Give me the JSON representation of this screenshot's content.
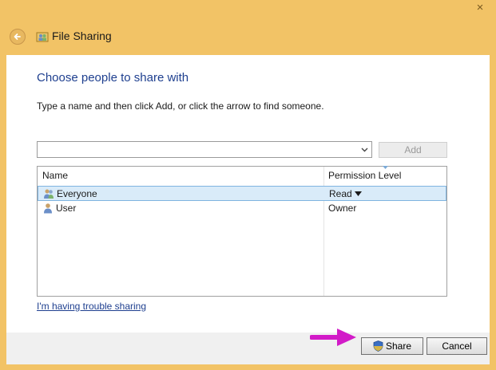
{
  "window": {
    "close_glyph": "×",
    "title": "File Sharing"
  },
  "dialog": {
    "heading": "Choose people to share with",
    "instructions": "Type a name and then click Add, or click the arrow to find someone.",
    "name_input": {
      "value": "",
      "placeholder": ""
    },
    "add_label": "Add",
    "table": {
      "columns": [
        "Name",
        "Permission Level"
      ],
      "rows": [
        {
          "name": "Everyone",
          "permission": "Read",
          "icon": "group-icon",
          "selected": true
        },
        {
          "name": "User",
          "permission": "Owner",
          "icon": "user-icon",
          "selected": false
        }
      ]
    },
    "trouble_link": "I'm having trouble sharing"
  },
  "footer": {
    "share_label": "Share",
    "cancel_label": "Cancel"
  },
  "colors": {
    "frame": "#f2c366",
    "heading": "#1e3f8f",
    "selection": "#d9ebf9",
    "annotation_arrow": "#d21bc8"
  }
}
